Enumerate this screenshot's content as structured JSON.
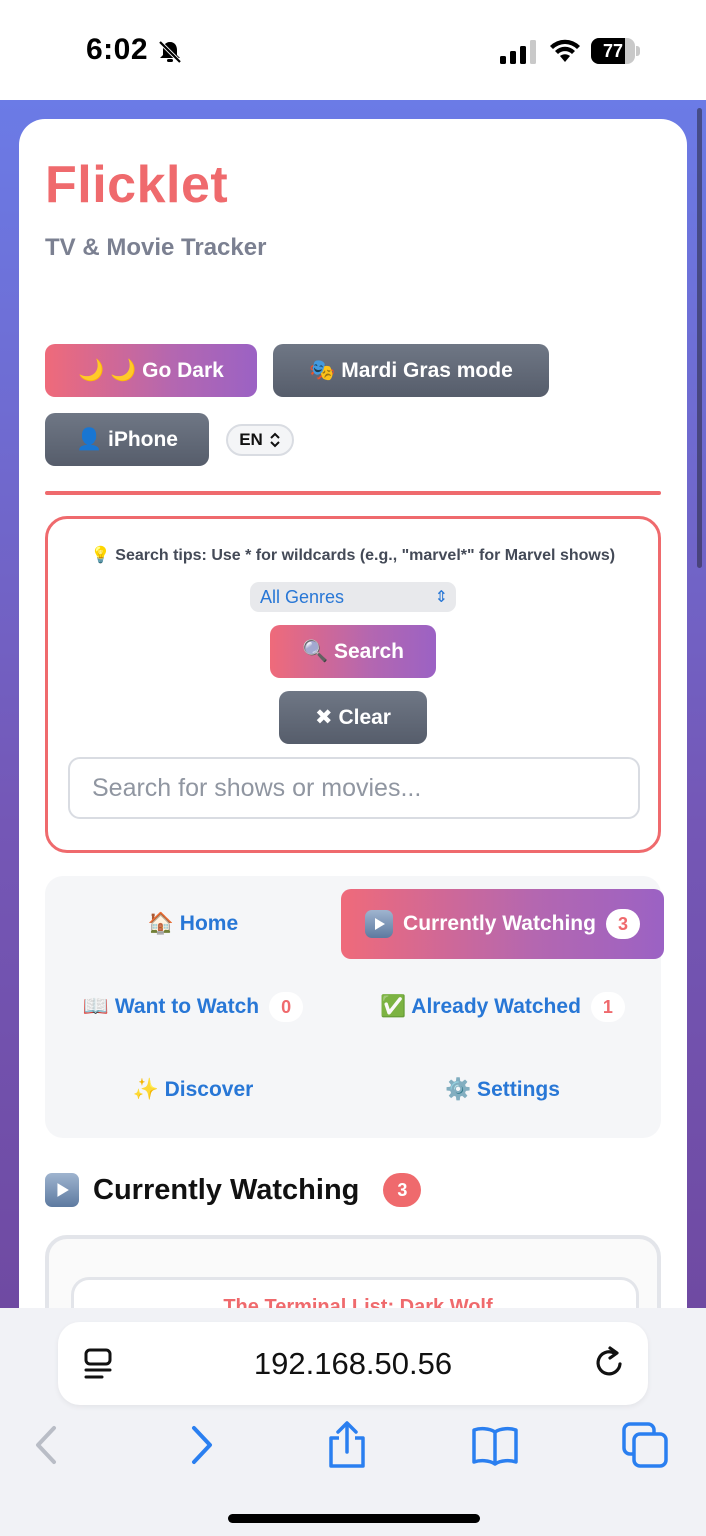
{
  "status_bar": {
    "time": "6:02",
    "battery": "77",
    "battery_level": 0.77
  },
  "app": {
    "title": "Flicklet",
    "subtitle": "TV & Movie Tracker"
  },
  "controls": {
    "go_dark": "🌙 🌙 Go Dark",
    "mardi_gras": "🎭 Mardi Gras mode",
    "user": "👤 iPhone",
    "language": "EN"
  },
  "search": {
    "tips": "💡 Search tips: Use * for wildcards (e.g., \"marvel*\" for Marvel shows)",
    "genre_selected": "All Genres",
    "search_button": "🔍 Search",
    "clear_button": "✖ Clear",
    "placeholder": "Search for shows or movies..."
  },
  "nav": {
    "home": "🏠 Home",
    "currently_watching": "Currently Watching",
    "currently_watching_count": "3",
    "want_to_watch": "📖 Want to Watch",
    "want_to_watch_count": "0",
    "already_watched": "✅ Already Watched",
    "already_watched_count": "1",
    "discover": "✨ Discover",
    "settings": "⚙️ Settings"
  },
  "section": {
    "title": "Currently Watching",
    "count": "3",
    "first_item_title": "The Terminal List: Dark Wolf"
  },
  "browser": {
    "url": "192.168.50.56"
  },
  "colors": {
    "accent": "#ef6a6d",
    "link": "#2877d6",
    "gradient_start": "#6b7be6",
    "gradient_end": "#6f4aa2"
  }
}
